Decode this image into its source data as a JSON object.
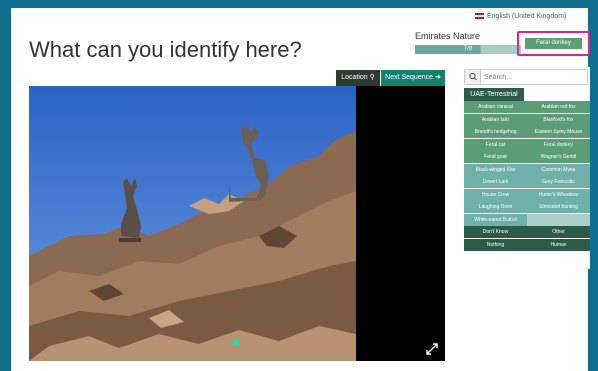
{
  "header": {
    "language": "English (United Kingdom)",
    "title": "What can you identify here?"
  },
  "project": {
    "name": "Emirates Nature",
    "progress_text": "7/8",
    "progress_fraction": 0.62
  },
  "selection": {
    "chosen_label": "Feral donkey"
  },
  "toolbar": {
    "location_label": "Location",
    "next_label": "Next Sequence"
  },
  "search": {
    "placeholder": "Search..."
  },
  "category": {
    "tab_label": "UAE-Terrestrial"
  },
  "species": [
    "Arabian caracal",
    "Arabian red fox",
    "Arabian tahr",
    "Blanford's fox",
    "Brandt's hedgehog",
    "Eastern Spiny Mouse",
    "Feral cat",
    "Feral donkey",
    "Feral goat",
    "Wagner's Gerbil",
    "Black-winged Kite",
    "Common Myna",
    "Desert Lark",
    "Grey Francolin",
    "House Crow",
    "Hume's Wheatear",
    "Laughing Dove",
    "Striolated bunting",
    "White-eared Bulbul",
    ""
  ],
  "actions": [
    "Don't Know",
    "Other",
    "Nothing",
    "Human"
  ],
  "colors": {
    "background": "#0e6f8f",
    "mammal_cell": "#5b9e75",
    "bird_cell": "#6fb0a8",
    "action_cell": "#2c5c49",
    "highlight": "#e91e8c"
  }
}
